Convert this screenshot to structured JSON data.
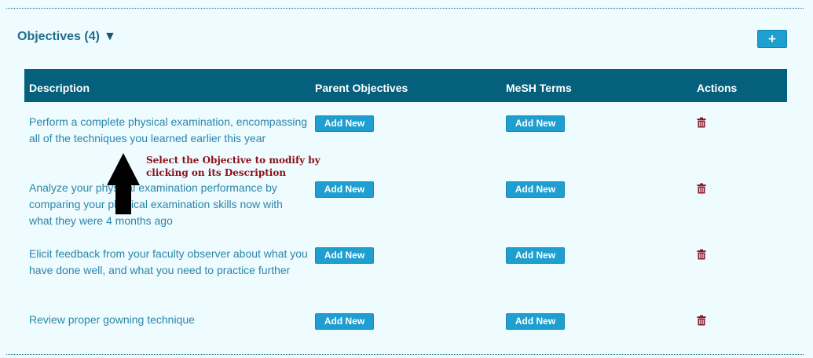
{
  "section": {
    "title": "Objectives (4)",
    "caret": "▼",
    "add_label": "+"
  },
  "table": {
    "headers": [
      "Description",
      "Parent Objectives",
      "MeSH Terms",
      "Actions"
    ],
    "rows": [
      {
        "description": "Perform a complete physical examination, encompassing all of the techniques you learned earlier this year",
        "parent_label": "Add New",
        "mesh_label": "Add New"
      },
      {
        "description": "Analyze your physical examination performance by comparing your physical examination skills now with what they were 4 months ago",
        "parent_label": "Add New",
        "mesh_label": "Add New"
      },
      {
        "description": "Elicit feedback from your faculty observer about what you have done well, and what you need to practice further",
        "parent_label": "Add New",
        "mesh_label": "Add New"
      },
      {
        "description": "Review proper gowning technique",
        "parent_label": "Add New",
        "mesh_label": "Add New"
      }
    ]
  },
  "annotation": {
    "line1": "Select the Objective to modify by",
    "line2": "clicking on its Description"
  },
  "icons": {
    "delete": "trash-icon",
    "pointer": "arrow-up-icon"
  },
  "colors": {
    "background": "#eefbff",
    "header_bg": "#05607e",
    "button_bg": "#1f9fd0",
    "link_text": "#2a86a8",
    "trash": "#8b1a2a",
    "annotation": "#8b1018"
  }
}
